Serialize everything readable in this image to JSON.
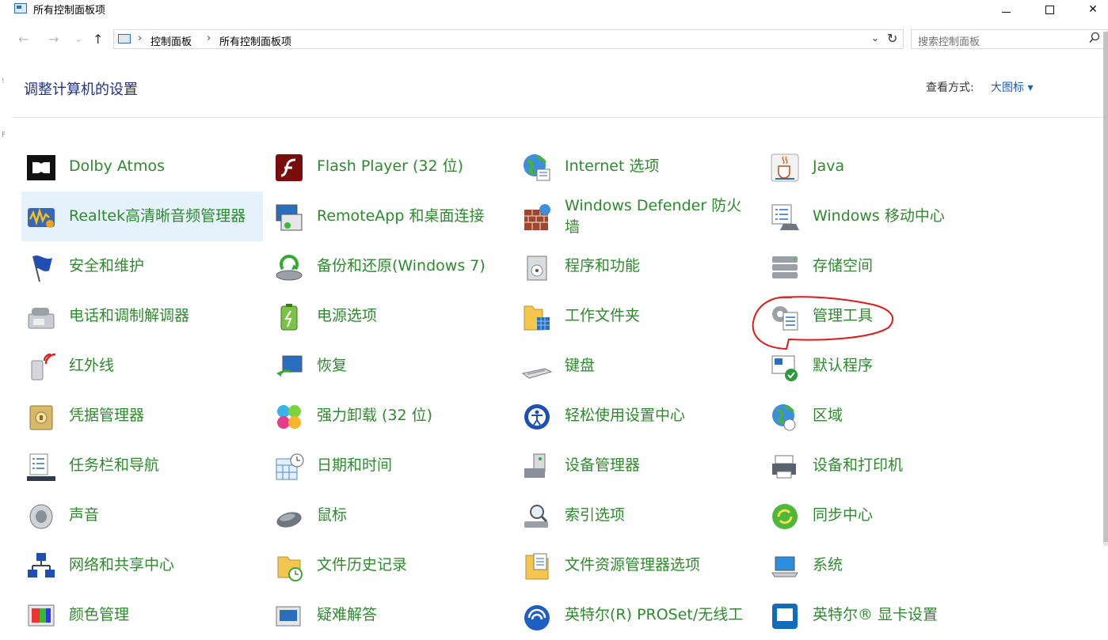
{
  "window": {
    "title": "所有控制面板项",
    "minimize_symbol": "—",
    "maximize_symbol": "☐",
    "close_symbol": "✕"
  },
  "nav": {
    "back": "←",
    "forward": "→",
    "recent": "⌄",
    "up": "↑"
  },
  "address": {
    "crumbs": [
      "控制面板",
      "所有控制面板项"
    ],
    "dropdown": "⌄",
    "refresh": "↻"
  },
  "search": {
    "placeholder": "搜索控制面板"
  },
  "header": {
    "title": "调整计算机的设置",
    "view_by_label": "查看方式:",
    "view_by_value": "大图标 ▾"
  },
  "columns": [
    [
      {
        "label": "Dolby Atmos",
        "icon": "dolby-icon"
      },
      {
        "label": "Realtek高清晰音频管理器",
        "icon": "realtek-audio-icon",
        "highlighted": true
      },
      {
        "label": "安全和维护",
        "icon": "security-flag-icon"
      },
      {
        "label": "电话和调制解调器",
        "icon": "phone-modem-icon"
      },
      {
        "label": "红外线",
        "icon": "infrared-icon"
      },
      {
        "label": "凭据管理器",
        "icon": "credential-safe-icon"
      },
      {
        "label": "任务栏和导航",
        "icon": "taskbar-icon"
      },
      {
        "label": "声音",
        "icon": "speaker-icon"
      },
      {
        "label": "网络和共享中心",
        "icon": "network-icon"
      },
      {
        "label": "颜色管理",
        "icon": "color-management-icon"
      }
    ],
    [
      {
        "label": "Flash Player (32 位)",
        "icon": "flash-icon"
      },
      {
        "label": "RemoteApp 和桌面连接",
        "icon": "remoteapp-icon"
      },
      {
        "label": "备份和还原(Windows 7)",
        "icon": "backup-icon"
      },
      {
        "label": "电源选项",
        "icon": "power-battery-icon"
      },
      {
        "label": "恢复",
        "icon": "recovery-icon"
      },
      {
        "label": "强力卸载 (32 位)",
        "icon": "uninstall-flower-icon"
      },
      {
        "label": "日期和时间",
        "icon": "calendar-clock-icon"
      },
      {
        "label": "鼠标",
        "icon": "mouse-icon"
      },
      {
        "label": "文件历史记录",
        "icon": "file-history-icon"
      },
      {
        "label": "疑难解答",
        "icon": "troubleshoot-icon"
      }
    ],
    [
      {
        "label": "Internet 选项",
        "icon": "internet-globe-icon"
      },
      {
        "label": "Windows Defender 防火墙",
        "icon": "firewall-icon",
        "wrap": true
      },
      {
        "label": "程序和功能",
        "icon": "programs-icon"
      },
      {
        "label": "工作文件夹",
        "icon": "work-folders-icon"
      },
      {
        "label": "键盘",
        "icon": "keyboard-icon"
      },
      {
        "label": "轻松使用设置中心",
        "icon": "ease-of-access-icon"
      },
      {
        "label": "设备管理器",
        "icon": "device-manager-icon"
      },
      {
        "label": "索引选项",
        "icon": "indexing-icon"
      },
      {
        "label": "文件资源管理器选项",
        "icon": "explorer-options-icon"
      },
      {
        "label": "英特尔(R) PROSet/无线工",
        "icon": "wireless-icon"
      }
    ],
    [
      {
        "label": "Java",
        "icon": "java-cup-icon"
      },
      {
        "label": "Windows 移动中心",
        "icon": "mobility-center-icon"
      },
      {
        "label": "存储空间",
        "icon": "storage-spaces-icon"
      },
      {
        "label": "管理工具",
        "icon": "admin-tools-icon",
        "circled": true
      },
      {
        "label": "默认程序",
        "icon": "default-programs-icon"
      },
      {
        "label": "区域",
        "icon": "region-globe-icon"
      },
      {
        "label": "设备和打印机",
        "icon": "printer-icon"
      },
      {
        "label": "同步中心",
        "icon": "sync-center-icon"
      },
      {
        "label": "系统",
        "icon": "system-laptop-icon"
      },
      {
        "label": "英特尔® 显卡设置",
        "icon": "intel-graphics-icon"
      }
    ]
  ],
  "colors": {
    "link_green": "#2d8a2d",
    "header_blue": "#1e3287",
    "view_blue": "#1a5eb8",
    "highlight": "#e5f1fb",
    "annotation_red": "#e0191b"
  }
}
